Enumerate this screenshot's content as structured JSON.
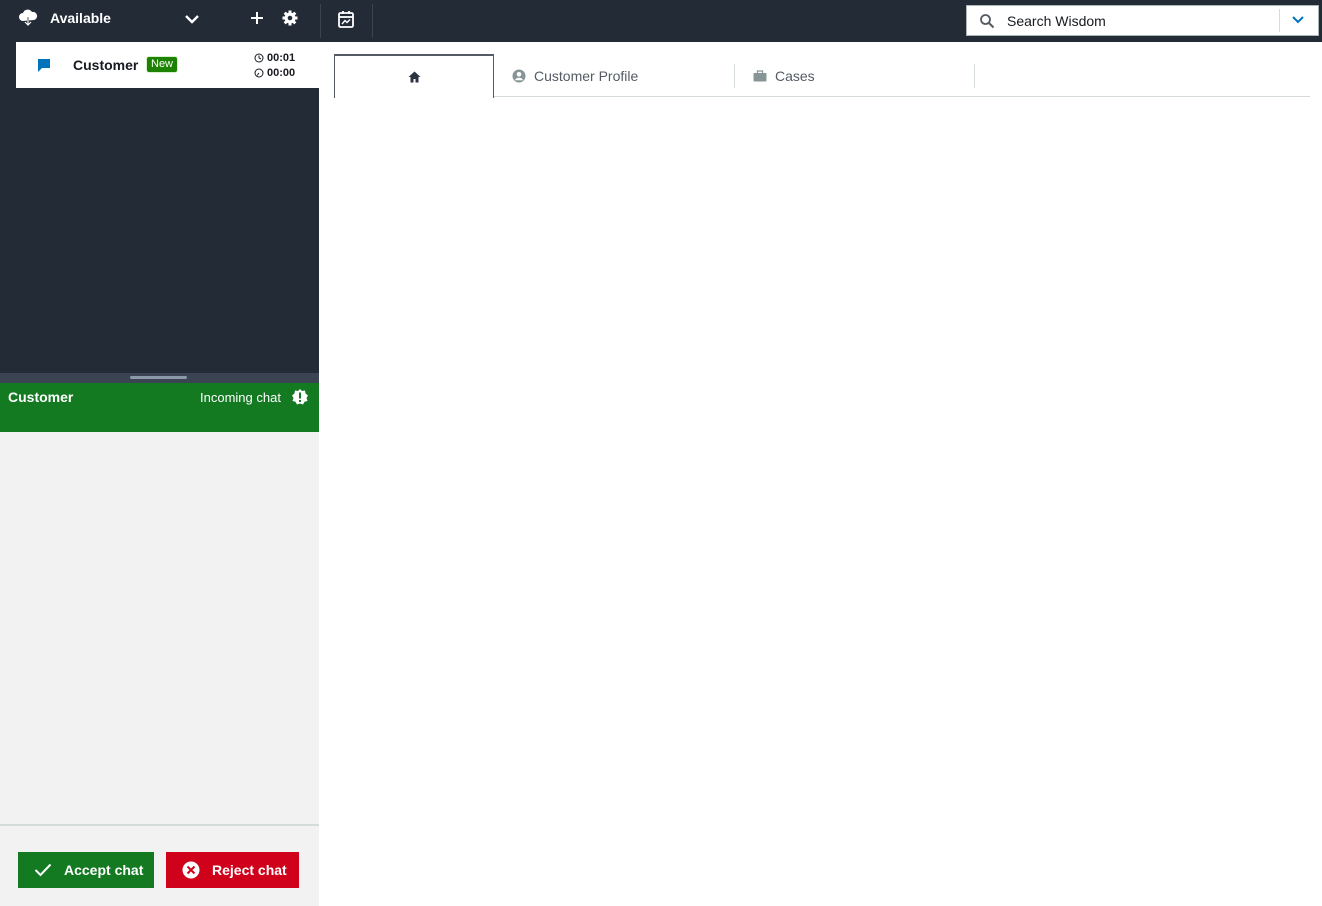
{
  "topbar": {
    "status_label": "Available",
    "search": {
      "placeholder": "Search Wisdom"
    }
  },
  "contact_card": {
    "name": "Customer",
    "badge": "New",
    "timer_total": "00:01",
    "timer_state": "00:00"
  },
  "incoming": {
    "name": "Customer",
    "status": "Incoming chat"
  },
  "actions": {
    "accept_label": "Accept chat",
    "reject_label": "Reject chat"
  },
  "tabs": [
    {
      "label": "",
      "icon": "home-icon"
    },
    {
      "label": "Customer Profile",
      "icon": "person-icon"
    },
    {
      "label": "Cases",
      "icon": "briefcase-icon"
    }
  ],
  "colors": {
    "topbar_bg": "#232b37",
    "accept_green": "#137a22",
    "reject_red": "#d0021b",
    "badge_green": "#1d8102",
    "link_blue": "#0073bb"
  }
}
